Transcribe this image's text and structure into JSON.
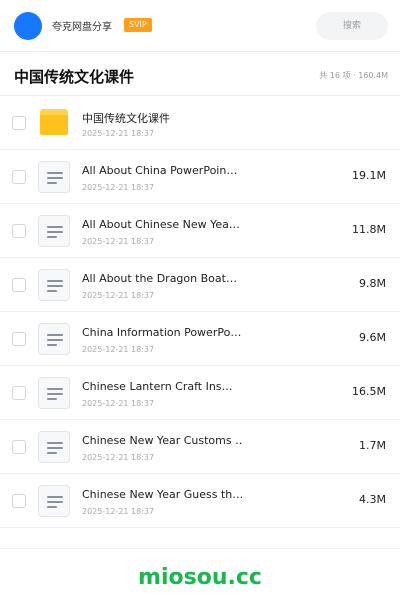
{
  "header": {
    "user_name": "夸克网盘分享",
    "badge": "SVIP",
    "search_placeholder": "搜索"
  },
  "title_bar": {
    "title": "中国传统文化课件",
    "summary": "共 16 项 · 160.4M"
  },
  "files": [
    {
      "type": "folder",
      "name": "中国传统文化课件",
      "date": "2025-12-21 18:37",
      "size": ""
    },
    {
      "type": "doc",
      "name": "All About China PowerPoin…",
      "date": "2025-12-21 18:37",
      "size": "19.1M"
    },
    {
      "type": "doc",
      "name": "All About Chinese New Yea…",
      "date": "2025-12-21 18:37",
      "size": "11.8M"
    },
    {
      "type": "doc",
      "name": "All About the Dragon Boat…",
      "date": "2025-12-21 18:37",
      "size": "9.8M"
    },
    {
      "type": "doc",
      "name": "China Information PowerPo…",
      "date": "2025-12-21 18:37",
      "size": "9.6M"
    },
    {
      "type": "doc",
      "name": "Chinese Lantern Craft Ins…",
      "date": "2025-12-21 18:37",
      "size": "16.5M"
    },
    {
      "type": "doc",
      "name": "Chinese New Year Customs …",
      "date": "2025-12-21 18:37",
      "size": "1.7M"
    },
    {
      "type": "doc",
      "name": "Chinese New Year Guess th…",
      "date": "2025-12-21 18:37",
      "size": "4.3M"
    }
  ],
  "footer": {
    "brand": "miosou.cc"
  },
  "colors": {
    "avatar": "#1677ff",
    "badge": "#ff9f1a",
    "brand": "#19b84f",
    "folder": "#ffc21a"
  }
}
